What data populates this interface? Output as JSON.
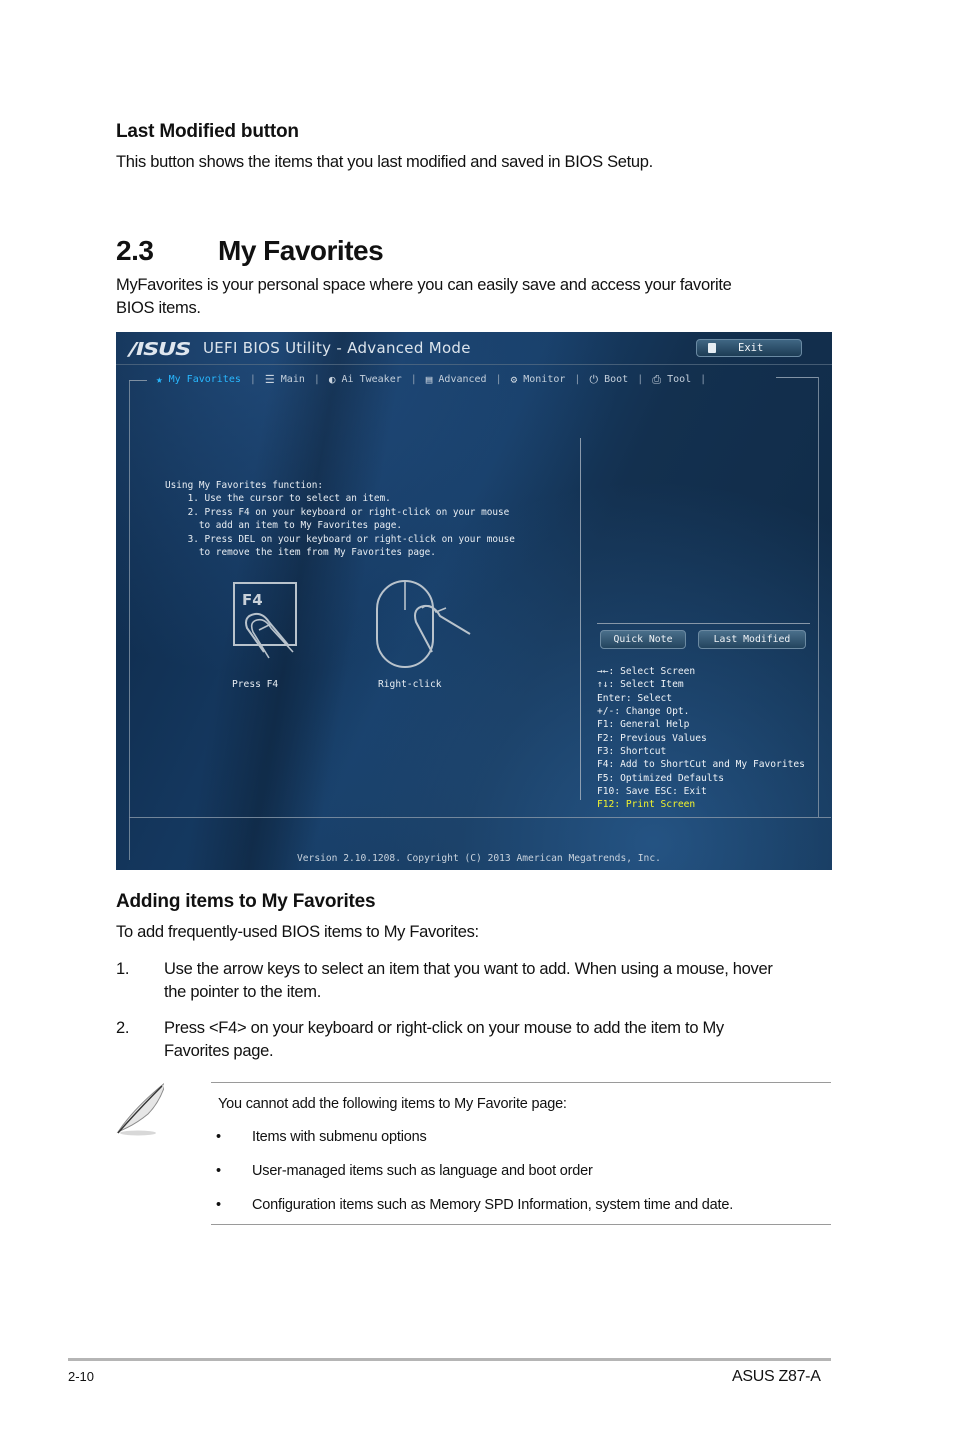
{
  "sections": {
    "last_modified": {
      "heading": "Last Modified button",
      "body": "This button shows the items that you last modified and saved in BIOS Setup."
    },
    "my_favorites": {
      "number": "2.3",
      "title": "My Favorites",
      "intro_line1": "MyFavorites is your personal space where you can easily save and access your favorite",
      "intro_line2": "BIOS items."
    },
    "adding": {
      "heading": "Adding items to My Favorites",
      "lead": "To add frequently-used BIOS items to My Favorites:",
      "steps": [
        {
          "num": "1.",
          "line1": "Use the arrow keys to select an item that you want to add. When using a mouse, hover",
          "line2": "the pointer to the item."
        },
        {
          "num": "2.",
          "line1": "Press <F4> on your keyboard or right-click on your mouse to add the item to My",
          "line2": "Favorites page."
        }
      ]
    },
    "note": {
      "icon": "feather-pen-icon",
      "lead": "You cannot add the following items to My Favorite page:",
      "bullet": "•",
      "items": [
        "Items with submenu options",
        "User-managed items such as language and boot order",
        "Configuration items such as Memory SPD Information, system time and date."
      ]
    }
  },
  "bios": {
    "logo": "/ISUS",
    "title": "UEFI BIOS Utility - Advanced Mode",
    "exit_label": "Exit",
    "nav": [
      {
        "label": "My Favorites",
        "icon": "star-icon",
        "glyph": "★",
        "active": true
      },
      {
        "label": "Main",
        "icon": "list-icon",
        "glyph": "☰",
        "active": false
      },
      {
        "label": "Ai Tweaker",
        "icon": "tweaker-icon",
        "glyph": "◐",
        "active": false
      },
      {
        "label": "Advanced",
        "icon": "advanced-icon",
        "glyph": "▤",
        "active": false
      },
      {
        "label": "Monitor",
        "icon": "monitor-icon",
        "glyph": "⚙",
        "active": false
      },
      {
        "label": "Boot",
        "icon": "power-icon",
        "glyph": "⏻",
        "active": false
      },
      {
        "label": "Tool",
        "icon": "printer-tool-icon",
        "glyph": "⎙",
        "active": false
      }
    ],
    "nav_separator": "|",
    "instructions": [
      "Using My Favorites function:",
      "    1. Use the cursor to select an item.",
      "    2. Press F4 on your keyboard or right-click on your mouse",
      "      to add an item to My Favorites page.",
      "    3. Press DEL on your keyboard or right-click on your mouse",
      "      to remove the item from My Favorites page."
    ],
    "illustrations": {
      "key_label": "F4",
      "press_f4": "Press F4",
      "right_click": "Right-click"
    },
    "buttons": {
      "quick_note": "Quick Note",
      "last_modified": "Last Modified"
    },
    "hotkeys": [
      "→←: Select Screen",
      "↑↓: Select Item",
      "Enter: Select",
      "+/-: Change Opt.",
      "F1: General Help",
      "F2: Previous Values",
      "F3: Shortcut",
      "F4: Add to ShortCut and My Favorites",
      "F5: Optimized Defaults",
      "F10: Save  ESC: Exit"
    ],
    "hotkey_highlight": "F12: Print Screen",
    "version": "Version 2.10.1208. Copyright (C) 2013 American Megatrends, Inc.",
    "colors": {
      "active_tab": "#28b8ff",
      "highlight_key": "#f3f32c"
    }
  },
  "footer": {
    "page_number": "2-10",
    "product": "ASUS Z87-A"
  }
}
